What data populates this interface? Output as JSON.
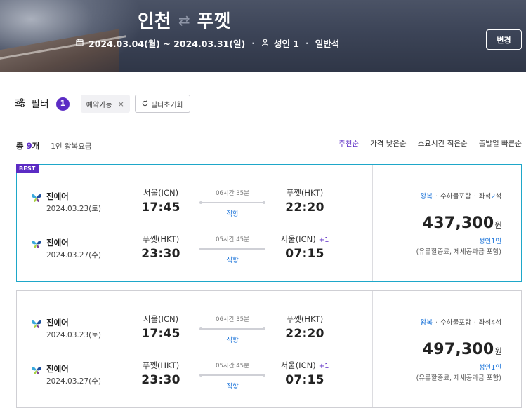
{
  "header": {
    "origin": "인천",
    "swap_icon": "⇄",
    "destination": "푸껫",
    "dates": "2024.03.04(월) ~ 2024.03.31(일)",
    "passengers": "성인 1",
    "cabin": "일반석",
    "change_label": "변경"
  },
  "filter": {
    "label": "필터",
    "count": "1",
    "chip_label": "예약가능",
    "chip_remove": "×",
    "reset_label": "필터초기화"
  },
  "summary": {
    "total_prefix": "총 ",
    "total_count": "9",
    "total_suffix": "개",
    "fare_basis": "1인 왕복요금"
  },
  "sort": {
    "options": [
      "추천순",
      "가격 낮은순",
      "소요시간 적은순",
      "출발일 빠른순"
    ],
    "active_index": 0
  },
  "colors": {
    "accent_purple": "#5b2bc4",
    "best_border": "#1ea7c9",
    "link_blue": "#1a73d9"
  },
  "results": [
    {
      "badge": "BEST",
      "legs": [
        {
          "airline": "진에어",
          "date": "2024.03.23(토)",
          "dep_city": "서울(ICN)",
          "dep_time": "17:45",
          "duration": "06시간 35분",
          "type": "직항",
          "arr_city": "푸껫(HKT)",
          "arr_time": "22:20",
          "day_plus": ""
        },
        {
          "airline": "진에어",
          "date": "2024.03.27(수)",
          "dep_city": "푸껫(HKT)",
          "dep_time": "23:30",
          "duration": "05시간 45분",
          "type": "직항",
          "arr_city": "서울(ICN)",
          "arr_time": "07:15",
          "day_plus": "+1"
        }
      ],
      "trip": "왕복",
      "baggage": "수하물포함",
      "seats_prefix": "좌석",
      "seats_count": "2",
      "seats_suffix": "석",
      "price": "437,300",
      "currency": "원",
      "pax": "성인1인",
      "includes": "(유류할증료, 제세공과금 포함)"
    },
    {
      "badge": "",
      "legs": [
        {
          "airline": "진에어",
          "date": "2024.03.23(토)",
          "dep_city": "서울(ICN)",
          "dep_time": "17:45",
          "duration": "06시간 35분",
          "type": "직항",
          "arr_city": "푸껫(HKT)",
          "arr_time": "22:20",
          "day_plus": ""
        },
        {
          "airline": "진에어",
          "date": "2024.03.27(수)",
          "dep_city": "푸껫(HKT)",
          "dep_time": "23:30",
          "duration": "05시간 45분",
          "type": "직항",
          "arr_city": "서울(ICN)",
          "arr_time": "07:15",
          "day_plus": "+1"
        }
      ],
      "trip": "왕복",
      "baggage": "수하물포함",
      "seats_prefix": "좌석",
      "seats_count": "4",
      "seats_suffix": "석",
      "price": "497,300",
      "currency": "원",
      "pax": "성인1인",
      "includes": "(유류할증료, 제세공과금 포함)"
    }
  ]
}
